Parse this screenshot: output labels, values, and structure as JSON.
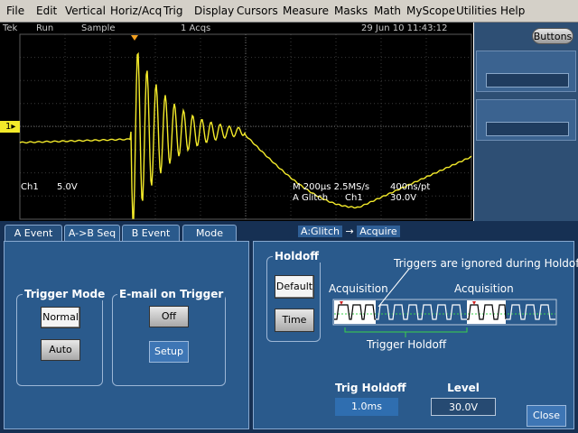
{
  "menu": [
    "File",
    "Edit",
    "Vertical",
    "Horiz/Acq",
    "Trig",
    "Display",
    "Cursors",
    "Measure",
    "Masks",
    "Math",
    "MyScope",
    "Utilities",
    "Help"
  ],
  "status": {
    "brand": "Tek",
    "run_state": "Run",
    "acq_mode": "Sample",
    "acq_count": "1 Acqs",
    "datetime": "29 Jun 10 11:43:12"
  },
  "display": {
    "ch1_marker": "1",
    "ch1_label": "Ch1",
    "ch1_scale": "5.0V",
    "horiz_readout": "M 200µs 2.5MS/s",
    "sample_interval": "400ns/pt",
    "trigger_readout": "A  Glitch",
    "trigger_source": "Ch1",
    "trigger_level": "30.0V",
    "trace_color": "#f3ea2a"
  },
  "side_panel": {
    "buttons_label": "Buttons"
  },
  "tabs": [
    {
      "label": "A Event",
      "active": true
    },
    {
      "label": "A->B Seq",
      "active": false
    },
    {
      "label": "B Event",
      "active": false
    },
    {
      "label": "Mode",
      "active": false
    }
  ],
  "breadcrumb": {
    "trigger": "A:Glitch",
    "arrow": "→",
    "target": "Acquire"
  },
  "trigger_mode": {
    "title": "Trigger Mode",
    "normal_label": "Normal",
    "auto_label": "Auto",
    "selected": "Normal"
  },
  "email_trigger": {
    "title": "E-mail on Trigger",
    "off_label": "Off",
    "setup_label": "Setup"
  },
  "holdoff": {
    "title": "Holdoff",
    "default_label": "Default",
    "time_label": "Time",
    "selected": "Default"
  },
  "diagram": {
    "ignored_note": "Triggers are ignored during Holdoff",
    "acquisition_left": "Acquisition",
    "acquisition_right": "Acquisition",
    "holdoff_label": "Trigger Holdoff"
  },
  "trig_holdoff": {
    "label": "Trig Holdoff",
    "value": "1.0ms"
  },
  "level": {
    "label": "Level",
    "value": "30.0V"
  },
  "close_label": "Close"
}
